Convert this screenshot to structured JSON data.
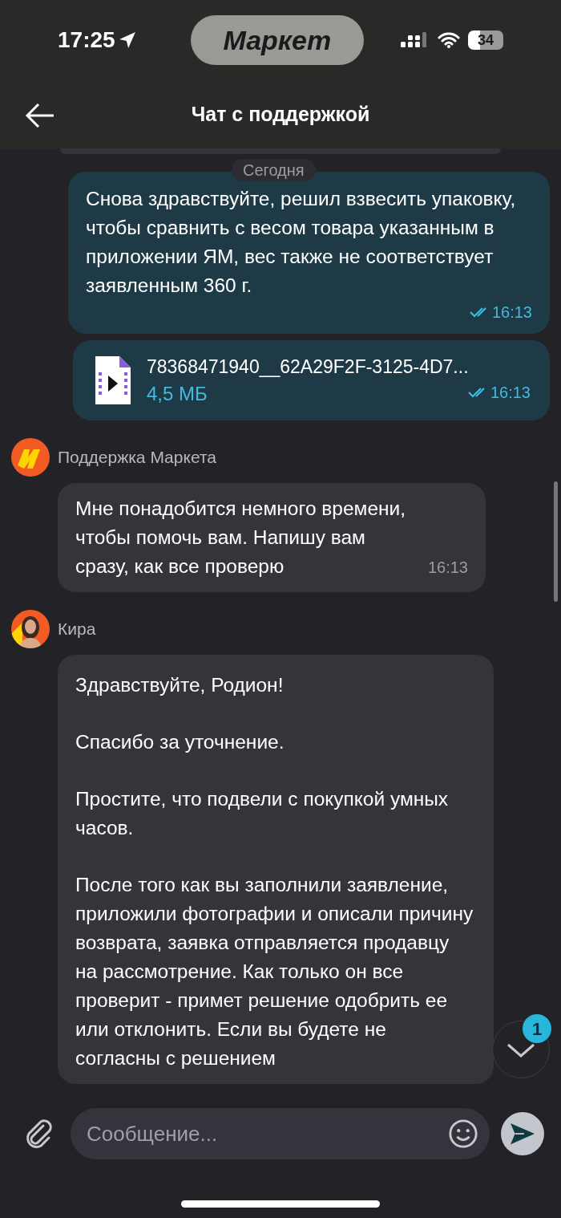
{
  "status_bar": {
    "time": "17:25",
    "app_pill": "Маркет",
    "battery": "34"
  },
  "header": {
    "title": "Чат с поддержкой"
  },
  "date_divider": "Сегодня",
  "outgoing": [
    {
      "kind": "text",
      "text": "Снова здравствуйте, решил взвесить упаковку, чтобы сравнить с весом товара указанным в приложении ЯМ, вес также не соответствует заявленным 360 г.",
      "time": "16:13",
      "read": true
    },
    {
      "kind": "file",
      "file_name": "78368471940__62A29F2F-3125-4D7...",
      "file_size": "4,5 МБ",
      "time": "16:13",
      "read": true
    }
  ],
  "incoming": [
    {
      "sender": "Поддержка Маркета",
      "kind": "logo",
      "paragraphs": [
        "Мне понадобится немного времени, чтобы помочь вам. Напишу вам сразу, как все проверю"
      ],
      "time": "16:13"
    },
    {
      "sender": "Кира",
      "kind": "person",
      "paragraphs": [
        "Здравствуйте, Родион!",
        "Спасибо за уточнение.",
        "Простите, что подвели с покупкой умных часов.",
        "После того как вы заполнили заявление, приложили фотографии и описали причину возврата, заявка отправляется продавцу на рассмотрение. Как только он все проверит - примет решение одобрить ее или отклонить. Если вы будете не согласны с решением"
      ]
    }
  ],
  "scroll_down": {
    "badge": "1"
  },
  "composer": {
    "placeholder": "Сообщение..."
  }
}
